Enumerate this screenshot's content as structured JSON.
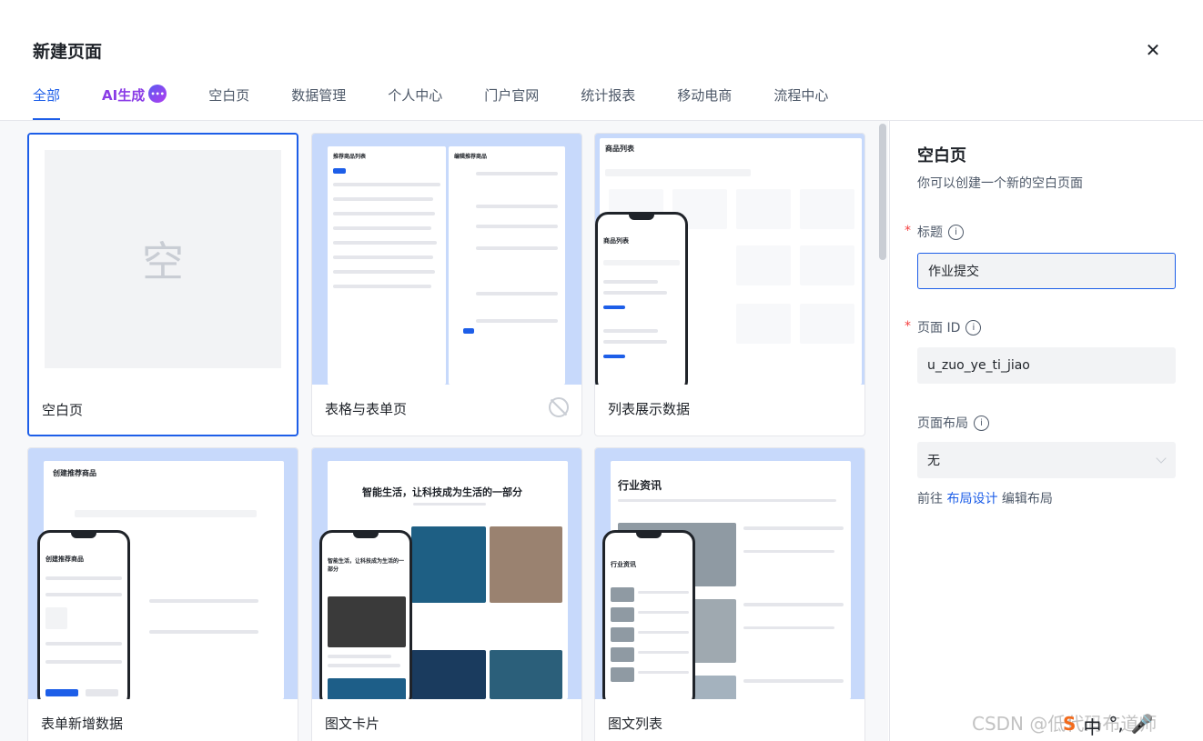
{
  "dialog": {
    "title": "新建页面",
    "close_icon": "close-icon"
  },
  "tabs": [
    {
      "label": "全部",
      "active": true
    },
    {
      "label": "AI生成",
      "ai": true
    },
    {
      "label": "空白页"
    },
    {
      "label": "数据管理"
    },
    {
      "label": "个人中心"
    },
    {
      "label": "门户官网"
    },
    {
      "label": "统计报表"
    },
    {
      "label": "移动电商"
    },
    {
      "label": "流程中心"
    }
  ],
  "templates": [
    {
      "label": "空白页",
      "placeholder": "空",
      "selected": true
    },
    {
      "label": "表格与表单页",
      "thumb_title": "推荐商品列表",
      "thumb_title_2": "编辑推荐商品"
    },
    {
      "label": "列表展示数据",
      "thumb_title": "商品列表",
      "thumb_title_2": "商品列表"
    },
    {
      "label": "表单新增数据",
      "thumb_title": "创建推荐商品",
      "thumb_title_2": "创建推荐商品"
    },
    {
      "label": "图文卡片",
      "thumb_title": "智能生活，让科技成为生活的一部分",
      "thumb_title_2": "智能生活，让科技成为生活的一部分"
    },
    {
      "label": "图文列表",
      "thumb_title": "行业资讯",
      "thumb_title_2": "行业资讯"
    }
  ],
  "side": {
    "title": "空白页",
    "desc": "你可以创建一个新的空白页面",
    "title_label": "标题",
    "title_value": "作业提交",
    "id_label": "页面 ID",
    "id_value": "u_zuo_ye_ti_jiao",
    "layout_label": "页面布局",
    "layout_value": "无",
    "layout_hint_prefix": "前往",
    "layout_hint_link": "布局设计",
    "layout_hint_suffix": "编辑布局"
  },
  "watermark": "CSDN @低代码布道师",
  "ime": {
    "mode": "中",
    "punct": "°,",
    "mic": "🎤"
  },
  "colors": {
    "accent": "#1d5ee8",
    "ai": "#8a3ce6",
    "thumb_bg": "#c7d9fb",
    "required": "#f53f3f"
  }
}
